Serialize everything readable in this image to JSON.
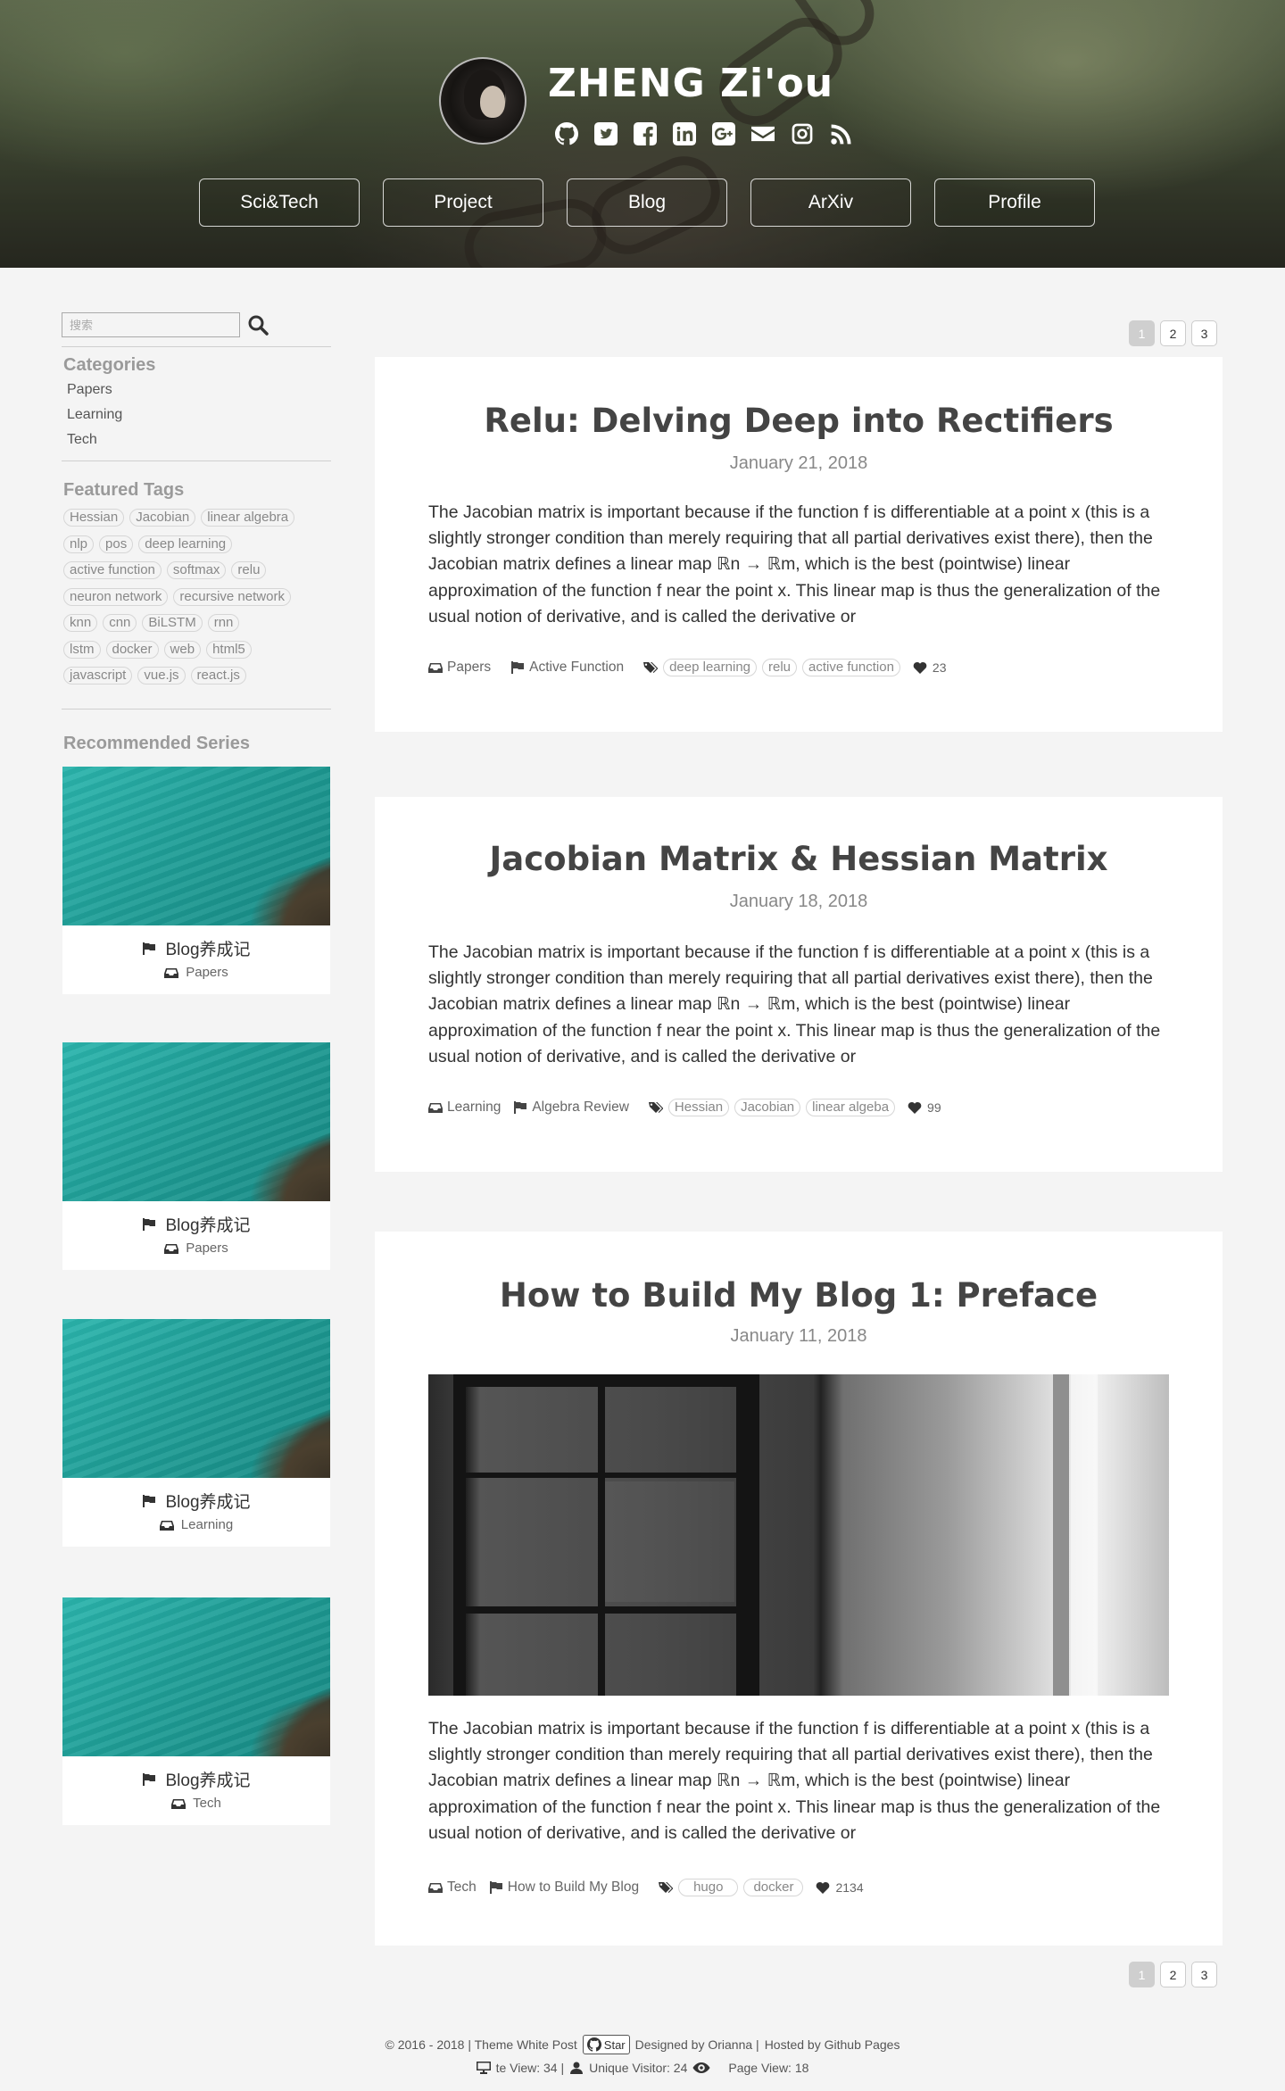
{
  "header": {
    "site_title": "ZHENG Zi'ou",
    "social_icons": [
      "github-icon",
      "twitter-icon",
      "facebook-icon",
      "linkedin-icon",
      "google-plus-icon",
      "email-icon",
      "instagram-icon",
      "rss-icon"
    ],
    "nav": [
      "Sci&Tech",
      "Project",
      "Blog",
      "ArXiv",
      "Profile"
    ]
  },
  "sidebar": {
    "search_placeholder": "搜索",
    "categories_heading": "Categories",
    "categories": [
      "Papers",
      "Learning",
      "Tech"
    ],
    "tags_heading": "Featured Tags",
    "tag_lines": [
      [
        "Hessian",
        "Jacobian",
        "linear algebra"
      ],
      [
        "nlp",
        "pos",
        "deep learning"
      ],
      [
        "active function",
        "softmax",
        "relu"
      ],
      [
        "neuron network",
        "recursive network"
      ],
      [
        "knn",
        "cnn",
        "BiLSTM",
        "rnn"
      ],
      [
        "lstm",
        "docker",
        "web",
        "html5"
      ],
      [
        "javascript",
        "vue.js",
        "react.js"
      ]
    ],
    "series_heading": "Recommended Series",
    "series": [
      {
        "title": "Blog养成记",
        "category": "Papers"
      },
      {
        "title": "Blog养成记",
        "category": "Papers"
      },
      {
        "title": "Blog养成记",
        "category": "Learning"
      },
      {
        "title": "Blog养成记",
        "category": "Tech"
      }
    ]
  },
  "pager": {
    "pages": [
      "1",
      "2",
      "3"
    ],
    "current": "1"
  },
  "posts": [
    {
      "title": "Relu: Delving Deep into Rectifiers",
      "date": "January 21, 2018",
      "excerpt": "The Jacobian matrix is important because if the function f is differentiable at a point x (this is a slightly stronger condition than merely requiring that all partial derivatives exist there), then the Jacobian matrix defines a linear map ℝn → ℝm, which is the best (pointwise) linear approximation of the function f near the point x. This linear map is thus the generalization of the usual notion of derivative, and is called the derivative or",
      "category": "Papers",
      "series": "Active Function",
      "tags": [
        "deep learning",
        "relu",
        "active function"
      ],
      "likes": "23"
    },
    {
      "title": "Jacobian Matrix & Hessian Matrix",
      "date": "January 18, 2018",
      "excerpt": "The Jacobian matrix is important because if the function f is differentiable at a point x (this is a slightly stronger condition than merely requiring that all partial derivatives exist there), then the Jacobian matrix defines a linear map ℝn → ℝm, which is the best (pointwise) linear approximation of the function f near the point x. This linear map is thus the generalization of the usual notion of derivative, and is called the derivative or",
      "category": "Learning",
      "series": "Algebra Review",
      "tags": [
        "Hessian",
        "Jacobian",
        "linear algeba"
      ],
      "likes": "99"
    },
    {
      "title": "How to Build My Blog 1: Preface",
      "date": "January 11, 2018",
      "excerpt": "The Jacobian matrix is important because if the function f is differentiable at a point x (this is a slightly stronger condition than merely requiring that all partial derivatives exist there), then the Jacobian matrix defines a linear map ℝn → ℝm, which is the best (pointwise) linear approximation of the function f near the point x. This linear map is thus the generalization of the usual notion of derivative, and is called the derivative or",
      "category": "Tech",
      "series": "How to Build My Blog",
      "tags": [
        "hugo",
        "docker"
      ],
      "likes": "2134"
    }
  ],
  "footer": {
    "copyright": "© 2016 - 2018 | Theme White Post",
    "star_label": "Star",
    "designed_by": "Designed by Orianna |",
    "hosted_by": "Hosted by Github Pages",
    "site_view": "te View: 34 |",
    "unique_visitor": "Unique Visitor: 24",
    "page_view": "Page View: 18"
  }
}
